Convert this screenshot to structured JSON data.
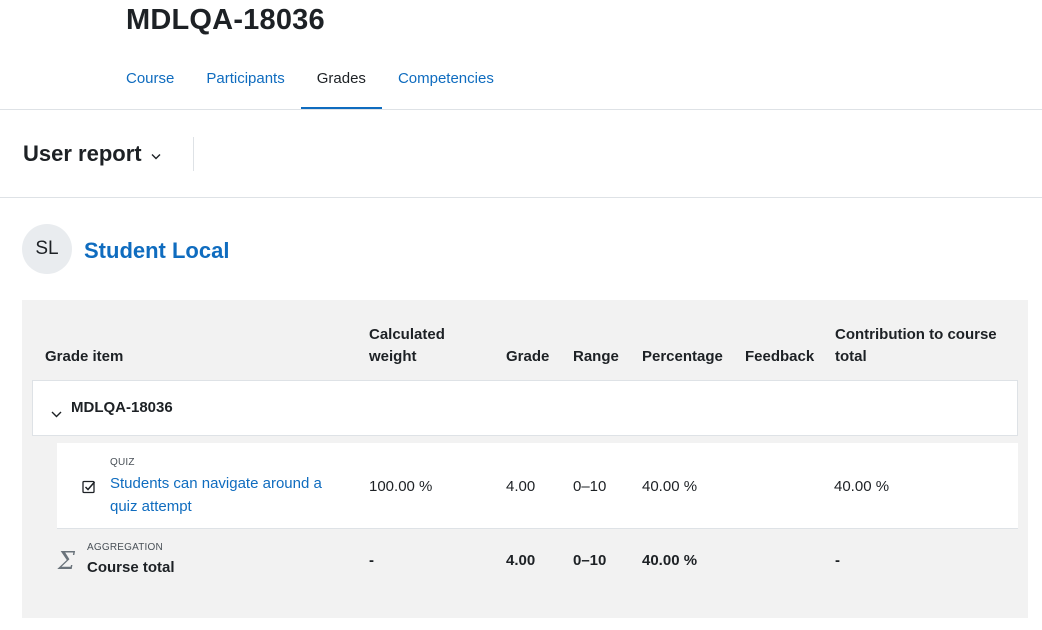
{
  "course": {
    "title": "MDLQA-18036"
  },
  "tabs": [
    {
      "label": "Course",
      "active": false
    },
    {
      "label": "Participants",
      "active": false
    },
    {
      "label": "Grades",
      "active": true
    },
    {
      "label": "Competencies",
      "active": false
    }
  ],
  "report_selector": {
    "label": "User report",
    "icon": "chevron-down-icon"
  },
  "user": {
    "initials": "SL",
    "name": "Student Local"
  },
  "table": {
    "headers": {
      "grade_item": "Grade item",
      "weight_line1": "Calculated",
      "weight_line2": "weight",
      "grade": "Grade",
      "range": "Range",
      "percentage": "Percentage",
      "feedback": "Feedback",
      "contribution_line1": "Contribution to course",
      "contribution_line2": "total"
    },
    "category": {
      "name": "MDLQA-18036",
      "icon": "chevron-down-icon"
    },
    "item": {
      "type": "QUIZ",
      "name": "Students can navigate around a quiz attempt",
      "icon": "quiz-checkbox-icon",
      "weight": "100.00 %",
      "grade": "4.00",
      "range": "0–10",
      "percentage": "40.00 %",
      "feedback": "",
      "contribution": "40.00 %"
    },
    "total": {
      "type": "AGGREGATION",
      "name": "Course total",
      "icon": "sigma-icon",
      "weight": "-",
      "grade": "4.00",
      "range": "0–10",
      "percentage": "40.00 %",
      "feedback": "",
      "contribution": "-"
    }
  },
  "colors": {
    "link": "#0f6cbf",
    "text": "#1d2125",
    "panel": "#f2f2f2",
    "border": "#dee2e6"
  }
}
